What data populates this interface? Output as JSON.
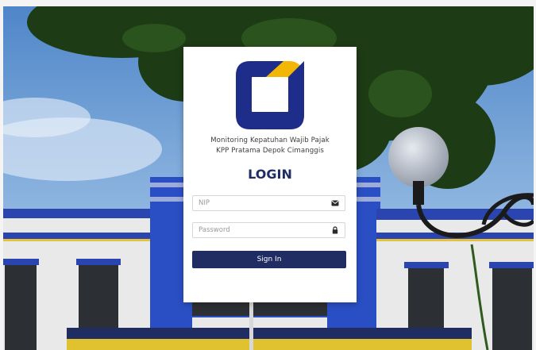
{
  "app": {
    "line1": "Monitoring Kepatuhan Wajib Pajak",
    "line2": "KPP Pratama Depok Cimanggis"
  },
  "login": {
    "title": "LOGIN",
    "nip_placeholder": "NIP",
    "password_placeholder": "Password",
    "signin_label": "Sign In"
  },
  "icons": {
    "nip": "envelope-icon",
    "password": "lock-icon",
    "logo": "app-logo"
  },
  "colors": {
    "primary": "#1f2d63",
    "logo_yellow": "#f2b705",
    "logo_blue": "#1f2d8a"
  }
}
